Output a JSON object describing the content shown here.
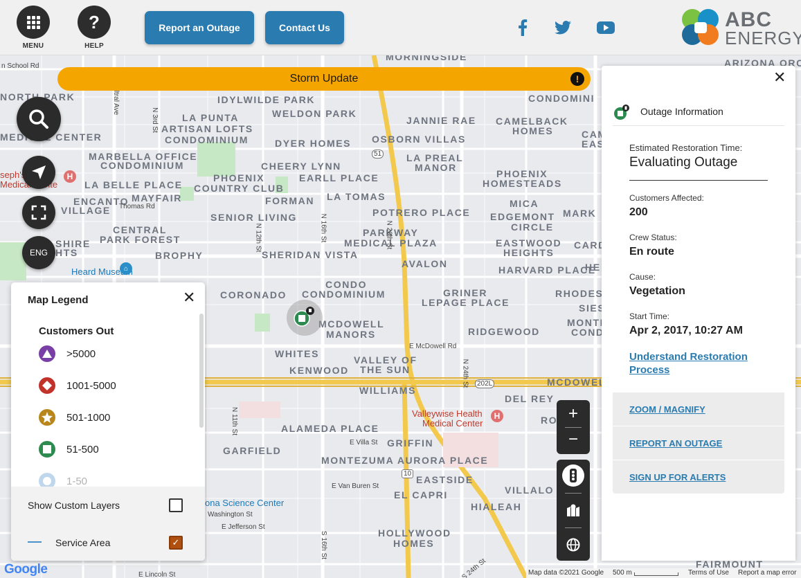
{
  "header": {
    "menu_label": "MENU",
    "help_label": "HELP",
    "report_outage_button": "Report an Outage",
    "contact_us_button": "Contact Us",
    "social": [
      "facebook-icon",
      "twitter-icon",
      "youtube-icon"
    ],
    "logo_line1": "ABC",
    "logo_line2": "ENERGY"
  },
  "storm_banner": {
    "text": "Storm Update",
    "icon": "!"
  },
  "controls": {
    "language_label": "ENG"
  },
  "legend": {
    "title": "Map Legend",
    "subtitle": "Customers Out",
    "items": [
      {
        "label": ">5000",
        "shape": "triangle",
        "color": "#7a3fa6"
      },
      {
        "label": "1001-5000",
        "shape": "diamond",
        "color": "#c0322a"
      },
      {
        "label": "501-1000",
        "shape": "star",
        "color": "#b8861a"
      },
      {
        "label": "51-500",
        "shape": "square",
        "color": "#2e8b4f"
      },
      {
        "label": "1-50",
        "shape": "circle",
        "color": "#4a90c9"
      }
    ],
    "show_custom_layers_label": "Show Custom Layers",
    "show_custom_layers_checked": false,
    "service_area_label": "Service Area",
    "service_area_checked": true
  },
  "info_panel": {
    "heading": "Outage Information",
    "ert_label": "Estimated Restoration Time:",
    "ert_value": "Evaluating Outage",
    "customers_label": "Customers Affected:",
    "customers_value": "200",
    "crew_label": "Crew Status:",
    "crew_value": "En route",
    "cause_label": "Cause:",
    "cause_value": "Vegetation",
    "start_label": "Start Time:",
    "start_value": "Apr 2, 2017, 10:27 AM",
    "restoration_link": "Understand Restoration Process",
    "actions": [
      "ZOOM / MAGNIFY",
      "REPORT AN OUTAGE",
      "SIGN UP FOR ALERTS"
    ]
  },
  "map": {
    "neighborhoods": [
      "IDYLWILDE PARK",
      "WELDON PARK",
      "LA PUNTA",
      "ARTISAN LOFTS",
      "CONDOMINIUM",
      "DYER HOMES",
      "OSBORN VILLAS",
      "JANNIE RAE",
      "CAMELBACK",
      "HOMES",
      "CONDOMINI",
      "MARBELLA OFFICE",
      "CONDOMINIUM",
      "CHEERY LYNN",
      "LA PREAL",
      "MANOR",
      "PHOENIX",
      "COUNTRY CLUB",
      "EARLL PLACE",
      "PHOENIX",
      "HOMESTEADS",
      "LA BELLE PLACE",
      "MAYFAIR",
      "FORMAN",
      "LA TOMAS",
      "ENCANTO",
      "VILLAGE",
      "POTRERO PLACE",
      "MICA",
      "EDGEMONT",
      "CIRCLE",
      "MARK",
      "SENIOR LIVING",
      "CENTRAL",
      "PARK FOREST",
      "PARKWAY",
      "MEDICAL PLAZA",
      "EASTWOOD",
      "HEIGHTS",
      "CARDINAL",
      "SHIRE",
      "HTS",
      "BROPHY",
      "SHERIDAN VISTA",
      "AVALON",
      "HARVARD PLACE",
      "CORONADO",
      "CONDO",
      "CONDOMINIUM",
      "GRINER",
      "LEPAGE PLACE",
      "RHODES",
      "MCDOWELL",
      "MANORS",
      "RIDGEWOOD",
      "MONTE",
      "CONDOM",
      "WHITES",
      "KENWOOD",
      "VALLEY OF",
      "THE SUN",
      "WILLIAMS",
      "MCDOWEL",
      "DEL REY",
      "ROOS",
      "ALAMEDA PLACE",
      "GRIFFIN",
      "GARFIELD",
      "MONTEZUMA AURORA PLACE",
      "EASTSIDE",
      "EL CAPRI",
      "VILLALO",
      "HIALEAH",
      "HOLLYWOOD",
      "HOMES",
      "FAIRMOUNT",
      "MORNINGSIDE",
      "ARIZONA ORCHARD",
      "NORTH PARK",
      "MEDICAL CENTER",
      "CAM",
      "EAST",
      "SIES",
      "HE"
    ],
    "streets": [
      "n School Rd",
      "Thomas Rd",
      "N 3rd St",
      "N 12th St",
      "N 16th St",
      "N 20th St",
      "N 24th St",
      "E McDowell Rd",
      "N 11th St",
      "E Villa St",
      "E Van Buren St",
      "Washington St",
      "E Jefferson St",
      "S 16th St",
      "S 24th St",
      "E Lincoln St",
      "ltral Ave",
      "51",
      "10",
      "202L"
    ],
    "pois": [
      "seph's",
      "Medical Cente",
      "al",
      "Heard Museum",
      "Valleywise Health",
      "Medical Center",
      "ona Science Center"
    ],
    "google_logo": "Google",
    "footer": [
      "Map data ©2021 Google",
      "500 m",
      "Terms of Use",
      "Report a map error"
    ]
  }
}
